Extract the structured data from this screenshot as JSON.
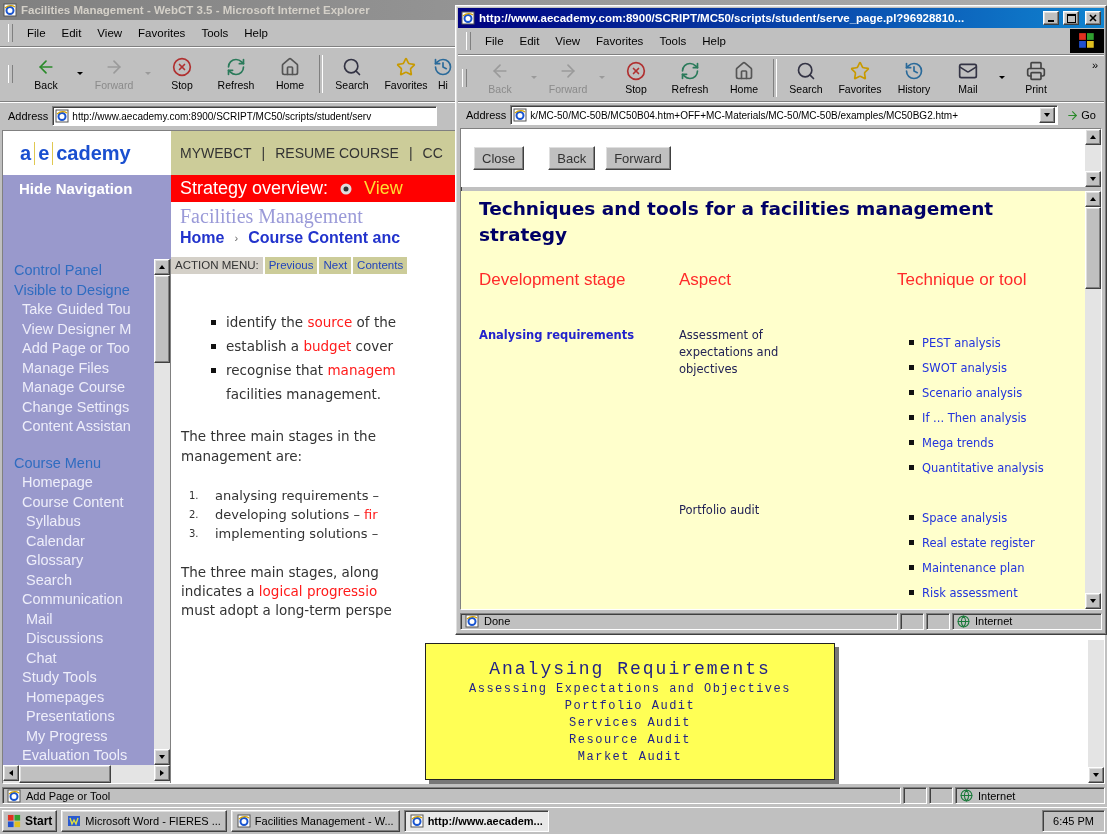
{
  "back_window": {
    "title": "Facilities Management - WebCT 3.5 - Microsoft Internet Explorer",
    "active": false,
    "menu": [
      "File",
      "Edit",
      "View",
      "Favorites",
      "Tools",
      "Help"
    ],
    "toolbar": [
      [
        {
          "kind": "back",
          "label": "Back",
          "disabled": false,
          "dropdown": true
        },
        {
          "kind": "forward",
          "label": "Forward",
          "disabled": true,
          "dropdown": true
        },
        {
          "kind": "stop",
          "label": "Stop",
          "disabled": false,
          "dropdown": false
        },
        {
          "kind": "refresh",
          "label": "Refresh",
          "disabled": false,
          "dropdown": false
        },
        {
          "kind": "home",
          "label": "Home",
          "disabled": false,
          "dropdown": false
        }
      ],
      [
        {
          "kind": "search",
          "label": "Search",
          "disabled": false,
          "dropdown": false
        },
        {
          "kind": "favorites",
          "label": "Favorites",
          "disabled": false,
          "dropdown": false
        },
        {
          "kind": "history",
          "label": "Hi",
          "disabled": false,
          "dropdown": false
        }
      ]
    ],
    "address": {
      "label": "Address",
      "url": "http://www.aecademy.com:8900/SCRIPT/MC50/scripts/student/serv"
    },
    "page": {
      "logo": [
        "a",
        "e",
        "cademy"
      ],
      "hide_navigation": "Hide Navigation",
      "nav_sections": [
        {
          "headings": [
            "Control Panel",
            "Visible to Designe"
          ],
          "items": [
            {
              "label": "Take Guided Tou"
            },
            {
              "label": "View Designer M"
            },
            {
              "label": "Add Page or Too"
            },
            {
              "label": "Manage Files"
            },
            {
              "label": "Manage Course"
            },
            {
              "label": "Change Settings"
            },
            {
              "label": "Content Assistan"
            }
          ]
        },
        {
          "headings": [
            "Course Menu"
          ],
          "items": [
            {
              "label": "Homepage"
            },
            {
              "label": "Course Content",
              "children": [
                {
                  "label": "Syllabus"
                },
                {
                  "label": "Calendar"
                },
                {
                  "label": "Glossary"
                },
                {
                  "label": "Search"
                }
              ]
            },
            {
              "label": "Communication",
              "children": [
                {
                  "label": "Mail"
                },
                {
                  "label": "Discussions"
                },
                {
                  "label": "Chat"
                }
              ]
            },
            {
              "label": "Study Tools",
              "children": [
                {
                  "label": "Homepages"
                },
                {
                  "label": "Presentations"
                },
                {
                  "label": "My Progress"
                }
              ]
            },
            {
              "label": "Evaluation Tools"
            }
          ]
        }
      ],
      "top_links": [
        "MYWEBCT",
        "RESUME COURSE",
        "CC"
      ],
      "top_link_separator": "|",
      "banner": {
        "title": "Strategy overview:",
        "option": "View"
      },
      "course_title": "Facilities Management",
      "breadcrumb": [
        "Home",
        "Course Content anc"
      ],
      "breadcrumb_separator": "›",
      "action_menu": {
        "label": "ACTION MENU:",
        "buttons": [
          "Previous",
          "Next",
          "Contents"
        ]
      },
      "content": [
        {
          "kind": "bullets",
          "items": [
            {
              "segments": [
                {
                  "text": "identify the "
                },
                {
                  "text": "source",
                  "emphasis": true
                },
                {
                  "text": " of the"
                }
              ]
            },
            {
              "segments": [
                {
                  "text": "establish a "
                },
                {
                  "text": "budget",
                  "emphasis": true
                },
                {
                  "text": " cover"
                }
              ]
            },
            {
              "segments": [
                {
                  "text": "recognise that "
                },
                {
                  "text": "managem",
                  "emphasis": true
                }
              ],
              "continuation": "facilities management."
            }
          ]
        },
        {
          "kind": "paragraph",
          "lines": [
            [
              {
                "text": "The three main stages in the"
              }
            ],
            [
              {
                "text": "management are:"
              }
            ]
          ]
        },
        {
          "kind": "numbered",
          "items": [
            {
              "number": "1.",
              "segments": [
                {
                  "text": "analysing requirements –"
                }
              ]
            },
            {
              "number": "2.",
              "segments": [
                {
                  "text": "developing solutions – "
                },
                {
                  "text": "fir",
                  "emphasis": true
                }
              ]
            },
            {
              "number": "3.",
              "segments": [
                {
                  "text": "implementing solutions –"
                }
              ]
            }
          ]
        },
        {
          "kind": "paragraph",
          "lines": [
            [
              {
                "text": "The three main stages, along"
              }
            ],
            [
              {
                "text": "indicates a "
              },
              {
                "text": "logical progressio",
                "emphasis": true
              }
            ],
            [
              {
                "text": "must adopt a long-term perspe"
              }
            ]
          ]
        }
      ]
    },
    "status": {
      "text": "Add Page or Tool",
      "zone": "Internet"
    }
  },
  "front_window": {
    "title": "http://www.aecademy.com:8900/SCRIPT/MC50/scripts/student/serve_page.pl?96928810...",
    "active": true,
    "menu": [
      "File",
      "Edit",
      "View",
      "Favorites",
      "Tools",
      "Help"
    ],
    "toolbar": [
      [
        {
          "kind": "back",
          "label": "Back",
          "disabled": true,
          "dropdown": true
        },
        {
          "kind": "forward",
          "label": "Forward",
          "disabled": true,
          "dropdown": true
        },
        {
          "kind": "stop",
          "label": "Stop",
          "disabled": false,
          "dropdown": false
        },
        {
          "kind": "refresh",
          "label": "Refresh",
          "disabled": false,
          "dropdown": false
        },
        {
          "kind": "home",
          "label": "Home",
          "disabled": false,
          "dropdown": false
        }
      ],
      [
        {
          "kind": "search",
          "label": "Search",
          "disabled": false,
          "dropdown": false
        },
        {
          "kind": "favorites",
          "label": "Favorites",
          "disabled": false,
          "dropdown": false
        },
        {
          "kind": "history",
          "label": "History",
          "disabled": false,
          "dropdown": false
        },
        {
          "kind": "mail",
          "label": "Mail",
          "disabled": false,
          "dropdown": true
        },
        {
          "kind": "print",
          "label": "Print",
          "disabled": false,
          "dropdown": false
        }
      ]
    ],
    "toolbar_more": "»",
    "address": {
      "label": "Address",
      "url": "k/MC-50/MC-50B/MC50B04.htm+OFF+MC-Materials/MC-50/MC-50B/examples/MC50BG2.htm+",
      "go": "Go"
    },
    "frame_buttons": [
      "Close",
      "Back",
      "Forward"
    ],
    "heading": "Techniques and tools for a facilities management strategy",
    "table": {
      "columns": [
        "Development stage",
        "Aspect",
        "Technique or tool"
      ],
      "rows": [
        {
          "stage": "Analysing requirements",
          "aspect": "Assessment of expectations and objectives",
          "tools": [
            "PEST analysis",
            "SWOT analysis",
            "Scenario analysis",
            "If ... Then analysis",
            "Mega trends",
            "Quantitative analysis"
          ]
        },
        {
          "aspect": "Portfolio audit",
          "tools": [
            "Space analysis",
            "Real estate register",
            "Maintenance plan",
            "Risk assessment"
          ]
        }
      ]
    },
    "status": {
      "text": "Done",
      "zone": "Internet"
    }
  },
  "tooltip": {
    "title": "Analysing Requirements",
    "lines": [
      "Assessing Expectations and Objectives",
      "Portfolio Audit",
      "Services Audit",
      "Resource Audit",
      "Market Audit"
    ]
  },
  "taskbar": {
    "start": "Start",
    "tasks": [
      {
        "kind": "word",
        "label": "Microsoft Word - FIERES ...",
        "selected": false
      },
      {
        "kind": "browser",
        "label": "Facilities Management - W...",
        "selected": false
      },
      {
        "kind": "browser",
        "label": "http://www.aecadem...",
        "selected": true
      }
    ],
    "clock": "6:45 PM"
  }
}
